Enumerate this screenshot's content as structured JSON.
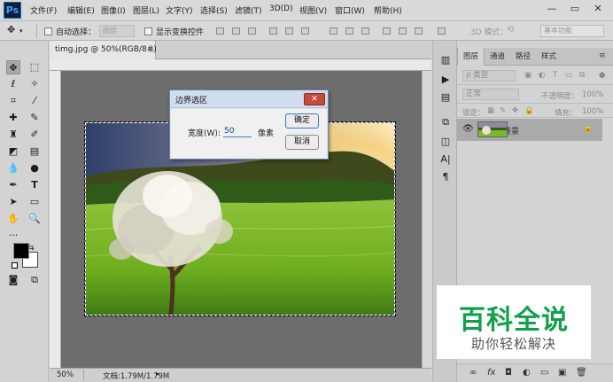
{
  "app": {
    "logo": "Ps"
  },
  "menu": [
    "文件(F)",
    "编辑(E)",
    "图像(I)",
    "图层(L)",
    "文字(Y)",
    "选择(S)",
    "滤镜(T)",
    "3D(D)",
    "视图(V)",
    "窗口(W)",
    "帮助(H)"
  ],
  "window_controls": {
    "minimize": "—",
    "restore": "▭",
    "close": "✕"
  },
  "options": {
    "auto_select_label": "自动选择：",
    "auto_select_value": "图层",
    "show_transform_label": "显示变换控件",
    "mode_3d_label": "3D 模式：",
    "workspace_value": "基本功能"
  },
  "document": {
    "tab_title": "timg.jpg @ 50%(RGB/8#)",
    "tab_close": "×",
    "zoom": "50%",
    "doc_info": "文档:1.79M/1.79M"
  },
  "dialog": {
    "title": "边界选区",
    "close": "✕",
    "width_label": "宽度(W):",
    "width_value": "50",
    "unit": "像素",
    "ok_label": "确定",
    "cancel_label": "取消"
  },
  "layers_panel": {
    "tabs": [
      "图层",
      "通道",
      "路径",
      "样式"
    ],
    "filter_label": "ρ 类型",
    "blend_mode": "正常",
    "opacity_label": "不透明度：",
    "opacity_value": "100%",
    "lock_label": "锁定：",
    "fill_label": "填充：",
    "fill_value": "100%",
    "layer_name": "背景",
    "bottom_icons": [
      "∞",
      "fx",
      "◘",
      "◐",
      "▭",
      "▣",
      "🗑"
    ]
  },
  "watermark": {
    "title": "百科全说",
    "subtitle": "助你轻松解决"
  },
  "colors": {
    "accent": "#3aa0ff",
    "watermark_green": "#12a04a"
  }
}
